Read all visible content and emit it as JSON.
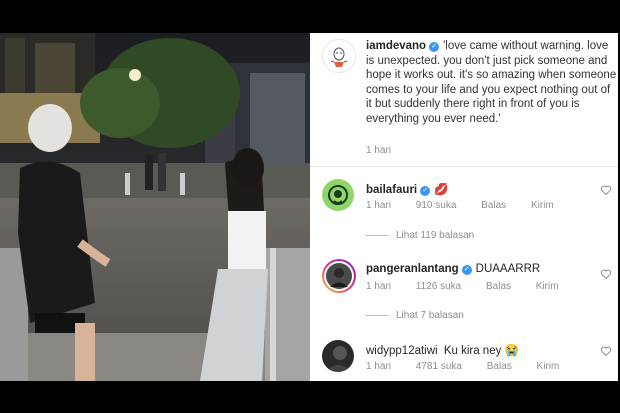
{
  "post": {
    "username": "iamdevano",
    "caption": "'love came without warning. love is unexpected. you don't just pick someone and hope it works out. it's so amazing when someone comes to your life and you expect nothing out of it but suddenly there right in front of you is everything you ever need.'",
    "time": "1 hari"
  },
  "comments": [
    {
      "username": "bailafauri",
      "text": "💋",
      "time": "1 hari",
      "likes": "910 suka",
      "reply": "Balas",
      "send": "Kirim",
      "view_replies": "Lihat 119 balasan"
    },
    {
      "username": "pangeranlantang",
      "text": "DUAAARRR",
      "time": "1 hari",
      "likes": "1126 suka",
      "reply": "Balas",
      "send": "Kirim",
      "view_replies": "Lihat 7 balasan"
    },
    {
      "username": "widypp12atiwi",
      "text": "Ku kira ney 😭",
      "time": "1 hari",
      "likes": "4781 suka",
      "reply": "Balas",
      "send": "Kirim"
    }
  ],
  "colors": {
    "verified": "#3897f0",
    "meta": "#8e8e8e",
    "accent_green": "#8fd66a"
  }
}
